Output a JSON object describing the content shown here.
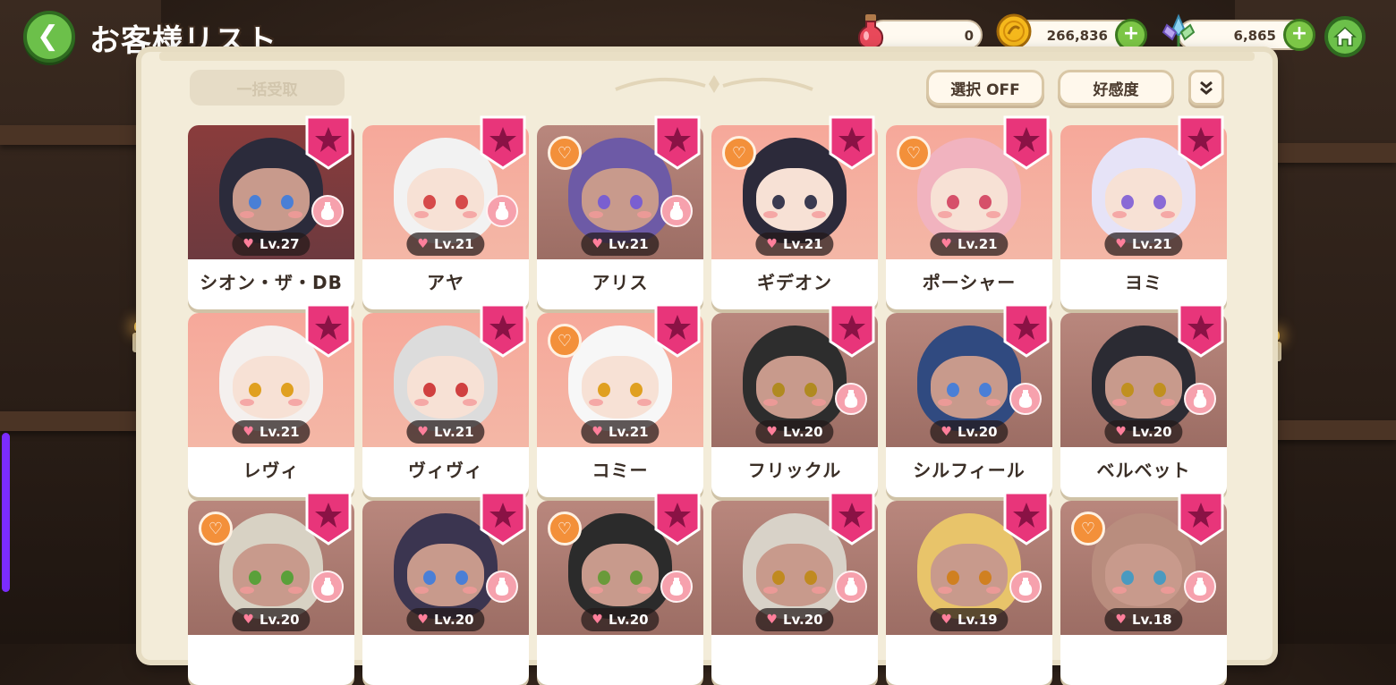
{
  "header": {
    "title": "お客様リスト",
    "back_icon": "chevron-left-icon",
    "home_icon": "home-icon"
  },
  "resources": [
    {
      "icon": "potion-icon",
      "value": "0",
      "has_plus": false
    },
    {
      "icon": "coin-icon",
      "value": "266,836",
      "has_plus": true
    },
    {
      "icon": "crystal-flower-icon",
      "value": "6,865",
      "has_plus": true
    }
  ],
  "toolbar": {
    "bulk_receive": "一括受取",
    "select_toggle": "選択 OFF",
    "sort_affinity": "好感度",
    "expand_icon": "double-chevron-down-icon"
  },
  "colors": {
    "accent_green": "#6cc04a",
    "badge_pink": "#e8357a",
    "heart_orange": "#f3903a",
    "bottle_pink": "#f6a1ad"
  },
  "cards": [
    {
      "name": "シオン・ザ・DB",
      "level": "Lv.27",
      "tone": "first",
      "heart": false,
      "bottle": true,
      "hair": "#2b2b3b",
      "eye": "#4a7fd6"
    },
    {
      "name": "アヤ",
      "level": "Lv.21",
      "tone": "bright",
      "heart": false,
      "bottle": true,
      "hair": "#f2f2f2",
      "eye": "#d64a4a"
    },
    {
      "name": "アリス",
      "level": "Lv.21",
      "tone": "dark",
      "heart": true,
      "bottle": true,
      "hair": "#6d5aa6",
      "eye": "#7a5fd0"
    },
    {
      "name": "ギデオン",
      "level": "Lv.21",
      "tone": "bright",
      "heart": true,
      "bottle": false,
      "hair": "#2c2a3a",
      "eye": "#3a3a50"
    },
    {
      "name": "ポーシャー",
      "level": "Lv.21",
      "tone": "bright",
      "heart": true,
      "bottle": false,
      "hair": "#f1b3bf",
      "eye": "#d6506a"
    },
    {
      "name": "ヨミ",
      "level": "Lv.21",
      "tone": "bright",
      "heart": false,
      "bottle": false,
      "hair": "#e6e3f7",
      "eye": "#8a6ad6"
    },
    {
      "name": "レヴィ",
      "level": "Lv.21",
      "tone": "bright",
      "heart": false,
      "bottle": false,
      "hair": "#f4f0ee",
      "eye": "#e0a020"
    },
    {
      "name": "ヴィヴィ",
      "level": "Lv.21",
      "tone": "bright",
      "heart": false,
      "bottle": false,
      "hair": "#dcdcdc",
      "eye": "#d04040"
    },
    {
      "name": "コミー",
      "level": "Lv.21",
      "tone": "bright",
      "heart": true,
      "bottle": false,
      "hair": "#f7f7f7",
      "eye": "#e0a020"
    },
    {
      "name": "フリックル",
      "level": "Lv.20",
      "tone": "dark",
      "heart": false,
      "bottle": true,
      "hair": "#2d2d2d",
      "eye": "#b08a20"
    },
    {
      "name": "シルフィール",
      "level": "Lv.20",
      "tone": "dark",
      "heart": false,
      "bottle": true,
      "hair": "#304a80",
      "eye": "#4a7fd6"
    },
    {
      "name": "ベルベット",
      "level": "Lv.20",
      "tone": "dark",
      "heart": false,
      "bottle": true,
      "hair": "#2b2b33",
      "eye": "#c09020"
    },
    {
      "name": "",
      "level": "Lv.20",
      "tone": "dark",
      "heart": true,
      "bottle": true,
      "hair": "#d8d2c4",
      "eye": "#5aa03a"
    },
    {
      "name": "",
      "level": "Lv.20",
      "tone": "dark",
      "heart": false,
      "bottle": true,
      "hair": "#3b3550",
      "eye": "#4a7fd6"
    },
    {
      "name": "",
      "level": "Lv.20",
      "tone": "dark",
      "heart": true,
      "bottle": true,
      "hair": "#2b2b2b",
      "eye": "#6a9a3a"
    },
    {
      "name": "",
      "level": "Lv.20",
      "tone": "dark",
      "heart": false,
      "bottle": true,
      "hair": "#d8d2c8",
      "eye": "#c08a20"
    },
    {
      "name": "",
      "level": "Lv.19",
      "tone": "dark",
      "heart": false,
      "bottle": true,
      "hair": "#e8c46a",
      "eye": "#d08020"
    },
    {
      "name": "",
      "level": "Lv.18",
      "tone": "dark",
      "heart": true,
      "bottle": true,
      "hair": "#b98d7e",
      "eye": "#4a9ac0"
    }
  ]
}
